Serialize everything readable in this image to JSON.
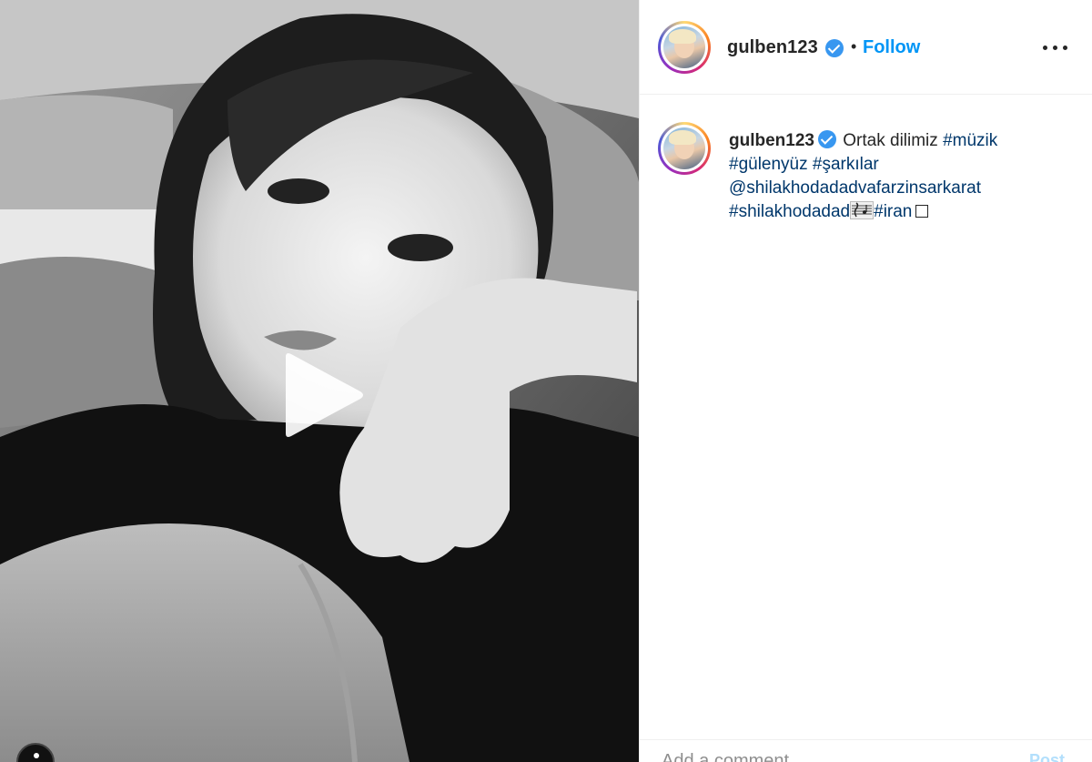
{
  "post": {
    "media_type": "video",
    "colors": {
      "link": "#00376b",
      "follow": "#0095f6",
      "verified": "#3897f0",
      "post_disabled": "#b2dffc"
    }
  },
  "header": {
    "username": "gulben123",
    "separator": "•",
    "follow_label": "Follow",
    "more_icon": "more-options-icon"
  },
  "caption": {
    "username": "gulben123",
    "text_lead": "Ortak dilimiz",
    "tags": {
      "muzik": "#müzik",
      "gulenyuz": "#gülenyüz",
      "sarkilar": "#şarkılar",
      "mention": "@shilakhodadadvafarzinsarkarat",
      "shilakhodadad": "#shilakhodadad",
      "iran": "#iran"
    }
  },
  "footer": {
    "comment_placeholder": "Add a comment...",
    "post_label": "Post"
  }
}
